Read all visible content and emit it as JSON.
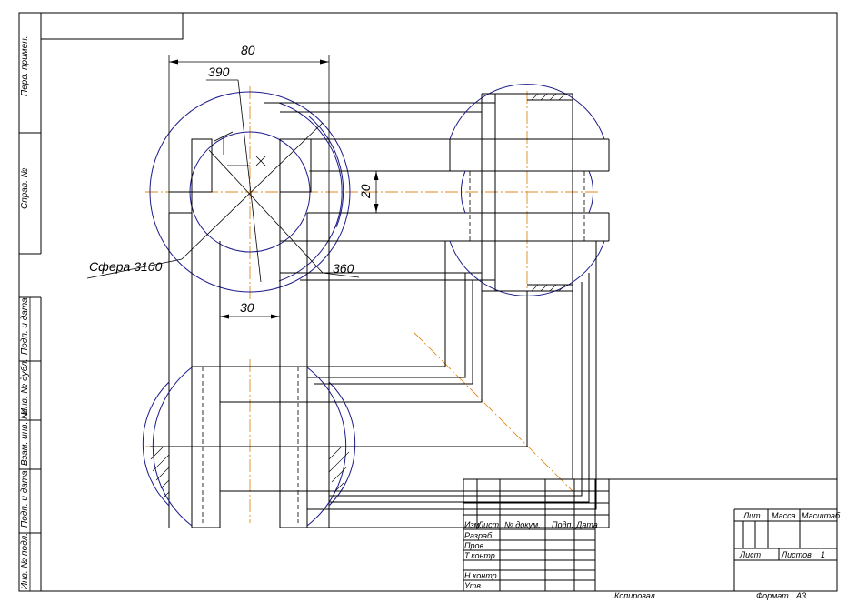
{
  "side_labels": {
    "perv_primen": "Перв. примен.",
    "sprav_no": "Справ. №",
    "podp_data_1": "Подп. и дата",
    "inv_dubl": "Инв. № дубл.",
    "vzam_inv": "Взам. инв. №",
    "podp_data_2": "Подп. и дата",
    "inv_podl": "Инв. № подл."
  },
  "dimensions": {
    "d80": "80",
    "d390": "390",
    "d20": "20",
    "d30": "30",
    "d360": "360",
    "sphere": "Сфера 3100"
  },
  "title_block": {
    "izm": "Изм.",
    "list": "Лист",
    "doc_no": "№ докум.",
    "podp": "Подп.",
    "data": "Дата",
    "razrab": "Разраб.",
    "prov": "Пров.",
    "t_kontr": "Т.контр.",
    "n_kontr": "Н.контр.",
    "utv": "Утв.",
    "lit": "Лит.",
    "massa": "Масса",
    "masshtab": "Масштаб",
    "list_right": "Лист",
    "listov": "Листов",
    "listov_count": "1",
    "kopiroval": "Копировал",
    "format": "Формат",
    "format_value": "А3"
  },
  "colors": {
    "line": "#000000",
    "contour": "#1a1a8c",
    "axis": "#e08a20"
  }
}
